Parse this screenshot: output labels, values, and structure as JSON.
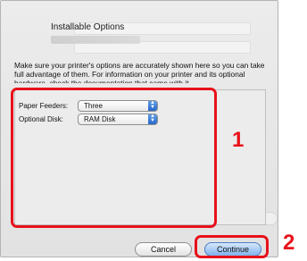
{
  "dialog": {
    "title": "Installable Options",
    "description": "Make sure your printer's options are accurately shown here so you can take full advantage of them.  For information on your printer and its optional hardware, check the documentation that came with it."
  },
  "options": [
    {
      "label": "Paper Feeders:",
      "value": "Three"
    },
    {
      "label": "Optional Disk:",
      "value": "RAM Disk"
    }
  ],
  "buttons": {
    "cancel": "Cancel",
    "continue": "Continue"
  },
  "callouts": {
    "one": "1",
    "two": "2"
  },
  "colors": {
    "callout_red": "#e8111a",
    "default_button_blue": "#7fb1ee"
  }
}
